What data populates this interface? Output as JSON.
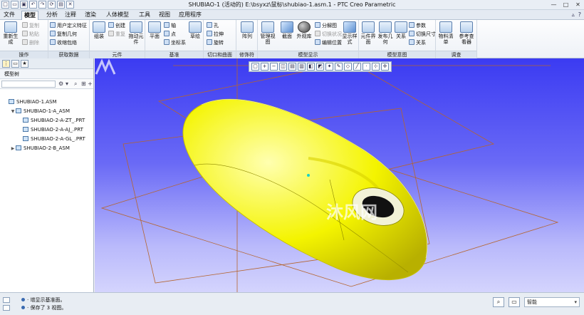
{
  "window": {
    "title": "SHUBIAO-1 (活动的) E:\\bsyxz\\鼠标\\shubiao-1.asm.1 - PTC Creo Parametric",
    "controls": [
      "minimize-icon",
      "maximize-icon",
      "close-icon"
    ]
  },
  "qat": [
    "new-icon",
    "open-icon",
    "save-icon",
    "undo-icon",
    "redo-icon",
    "regenerate-icon",
    "window-icon",
    "close-window-icon"
  ],
  "tabs": [
    "文件",
    "模型",
    "分析",
    "注释",
    "渲染",
    "人体模型",
    "工具",
    "视图",
    "应用程序"
  ],
  "active_tab": "模型",
  "ribbon": {
    "groups": {
      "operations": "操作",
      "get_data": "获取数据",
      "component": "元件",
      "datum": "基准",
      "cut_surface": "切口和曲面",
      "modifiers": "修饰符",
      "model_display": "模型显示",
      "model_intent": "模型意图",
      "investigate": "调查"
    },
    "ops": {
      "regenerate": "重新生成",
      "copy": "复制",
      "paste": "粘贴",
      "delete": "删除"
    },
    "get": {
      "udf": "用户定义特征",
      "copy_geom": "复制几何",
      "shrinkwrap": "收缩包络"
    },
    "comp": {
      "assemble": "组装",
      "create": "创建",
      "repeat": "重复",
      "drag": "拖动元件"
    },
    "datum": {
      "plane": "平面",
      "axis": "轴",
      "point": "点",
      "csys": "坐标系",
      "sketch": "草绘"
    },
    "cut": {
      "hole": "孔",
      "extrude": "拉伸",
      "revolve": "旋转"
    },
    "mod": {
      "pattern": "阵列"
    },
    "display": {
      "manage_views": "管理视图",
      "section": "截面",
      "appearance": "外观库",
      "exploded": "分解图",
      "toggle_status": "切换状况",
      "edit_position": "编辑位置",
      "display_style": "显示样式"
    },
    "intent": {
      "component_interface": "元件界面",
      "publish_geom": "发布几何",
      "relations": "关系",
      "params": "参数",
      "toggle_dims": "切换尺寸",
      "d_relations": "关系"
    },
    "invest": {
      "bom": "物料清单",
      "reference_viewer": "参考查看器"
    }
  },
  "left_panel": {
    "header": "模型树",
    "tree": [
      {
        "label": "SHUBIAO-1.ASM",
        "indent": 0,
        "expander": ""
      },
      {
        "label": "SHUBIAO-1-A_ASM",
        "indent": 1,
        "expander": "▼"
      },
      {
        "label": "SHUBIAO-2-A-ZT_.PRT",
        "indent": 2,
        "expander": ""
      },
      {
        "label": "SHUBIAO-2-A-AJ_.PRT",
        "indent": 2,
        "expander": ""
      },
      {
        "label": "SHUBIAO-2-A-GL_.PRT",
        "indent": 2,
        "expander": ""
      },
      {
        "label": "SHUBIAO-2-B_ASM",
        "indent": 1,
        "expander": "▶"
      }
    ]
  },
  "viewport": {
    "watermark": "沐风网",
    "toolbar": [
      "zoom-fit-icon",
      "zoom-in-icon",
      "zoom-out-icon",
      "repaint-icon",
      "view-manager-icon",
      "saved-views-icon",
      "section-icon",
      "display-style-icon",
      "datum-display-icon",
      "annotation-icon",
      "plane-display-icon",
      "axis-display-icon",
      "point-display-icon",
      "csys-display-icon",
      "spin-center-icon"
    ]
  },
  "status": {
    "messages": [
      "· 增显示基准面。",
      "· 保存了 3 视图。"
    ],
    "filter": "智能"
  },
  "colors": {
    "viewport_top": "#3b3bf2",
    "model": "#f6f600",
    "accent": "#2d5fa8"
  }
}
